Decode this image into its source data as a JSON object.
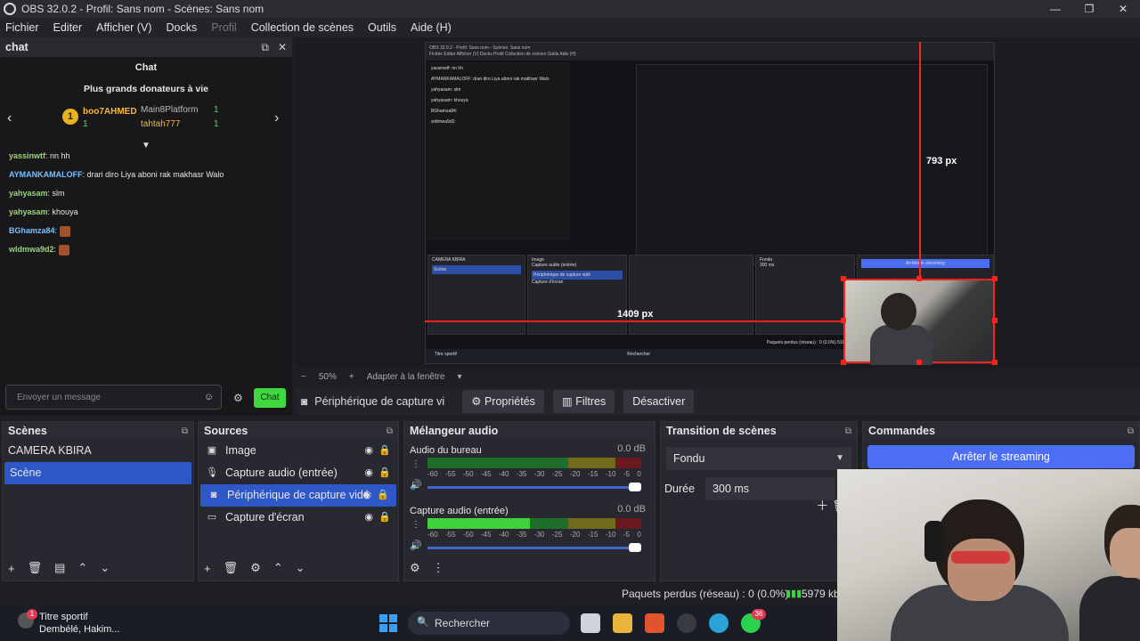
{
  "window": {
    "title": "OBS 32.0.2 - Profil: Sans nom - Scènes: Sans nom",
    "controls": [
      "—",
      "❐",
      "✕"
    ]
  },
  "menu": [
    "Fichier",
    "Editer",
    "Afficher (V)",
    "Docks",
    "Profil",
    "Collection de scènes",
    "Outils",
    "Aide (H)"
  ],
  "chat": {
    "title": "chat",
    "subtitle": "Chat",
    "donors_title": "Plus grands donateurs à vie",
    "donor1_rank": "1",
    "donor1_name": "boo7AHMED",
    "donor1_amount": "1",
    "donor2_name": "Main8Platform",
    "donor2_amount": "1",
    "donor3_name": "tahtah777",
    "donor3_amount": "1",
    "messages": [
      {
        "user": "yassinwtf",
        "text": ": nn hh"
      },
      {
        "user": "AYMANKAMALOFF",
        "text": ": drari diro Liya aboni rak makhasr Walo"
      },
      {
        "user": "yahyasam",
        "text": ": slm"
      },
      {
        "user": "yahyasam",
        "text": ": khouya"
      },
      {
        "user": "BGhamza84",
        "text": ":"
      },
      {
        "user": "wldmwa9d2",
        "text": ":"
      }
    ],
    "input_placeholder": "Envoyer un message",
    "send_label": "Chat"
  },
  "preview": {
    "zoom": "50%",
    "fit_label": "Adapter à la fenêtre",
    "width_label": "793 px",
    "height_label": "1409 px",
    "mini": {
      "menu": "Fichier  Editer  Afficher (V)  Docks  Profil  Collection de scènes  Outils  Aide (H)",
      "title": "OBS 32.0.2 - Profil: Sans nom - Scènes: Sans nom",
      "scene1": "CAMERA KBIRA",
      "scene2": "Scène",
      "src1": "Image",
      "src2": "Capture audio (entrée)",
      "src3": "Périphérique de capture vidé",
      "src4": "Capture d'écran",
      "cmd": "Arrêter le streaming",
      "fade": "Fondu",
      "duration": "300 ms",
      "status": "Paquets perdus (réseau) : 0 (0.0%)     5164 kb",
      "news": "Titre sportif",
      "news_sub": "Dembélé, Hakim...",
      "search": "Rechercher",
      "chat_lines": [
        "yassinwtf: nn hh",
        "AYMANKAMALOFF: drari diro Liya aboni rak makhasr Walo",
        "yahyasam: slm",
        "yahyasam: khouya",
        "BGhamza84:",
        "wldmwa9d2:"
      ]
    }
  },
  "source_toolbar": {
    "source_name": "Périphérique de capture vi",
    "properties": "Propriétés",
    "filters": "Filtres",
    "deactivate": "Désactiver"
  },
  "scenes": {
    "title": "Scènes",
    "items": [
      "CAMERA KBIRA",
      "Scène"
    ]
  },
  "sources": {
    "title": "Sources",
    "items": [
      "Image",
      "Capture audio (entrée)",
      "Périphérique de capture vidé",
      "Capture d'écran"
    ]
  },
  "mixer": {
    "title": "Mélangeur audio",
    "channels": [
      {
        "name": "Audio du bureau",
        "db": "0.0 dB",
        "level": 0
      },
      {
        "name": "Capture audio (entrée)",
        "db": "0.0 dB",
        "level": 0.48
      }
    ],
    "ticks": [
      "-60",
      "-55",
      "-50",
      "-45",
      "-40",
      "-35",
      "-30",
      "-25",
      "-20",
      "-15",
      "-10",
      "-5",
      "0"
    ]
  },
  "transition": {
    "title": "Transition de scènes",
    "type": "Fondu",
    "duration_label": "Durée",
    "duration": "300 ms"
  },
  "commands": {
    "title": "Commandes",
    "stop_stream": "Arrêter le streaming"
  },
  "status": {
    "dropped": "Paquets perdus (réseau) : 0 (0.0%)",
    "bitrate": "5979 kb"
  },
  "taskbar": {
    "news_title": "Titre sportif",
    "news_sub": "Dembélé, Hakim...",
    "news_badge": "1",
    "search": "Rechercher",
    "whatsapp_badge": "36"
  },
  "colors": {
    "accent": "#2e57c7",
    "command": "#4c6ef5",
    "chat_button": "#3fd83f",
    "selection_outline": "#ff2020"
  }
}
